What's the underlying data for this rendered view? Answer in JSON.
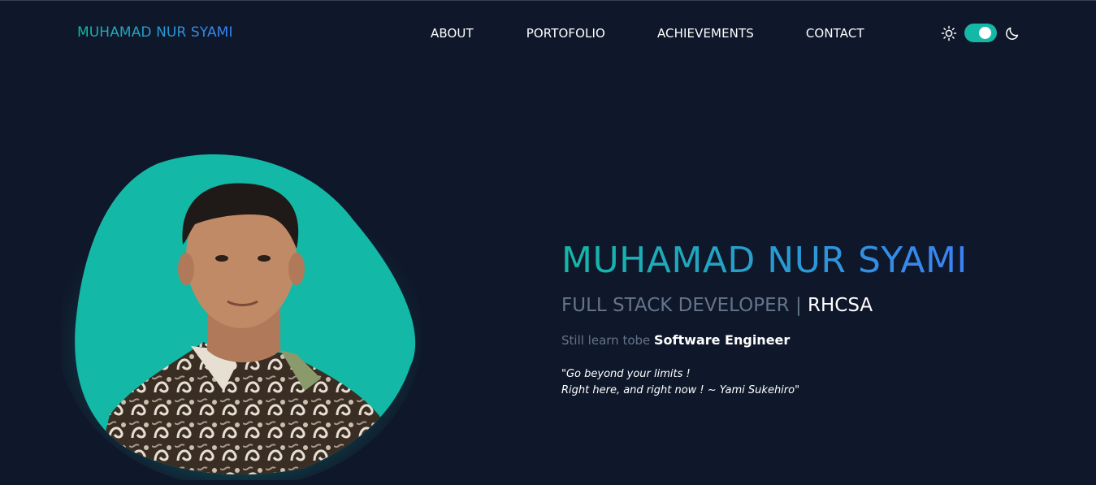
{
  "navbar": {
    "brand": "MUHAMAD NUR SYAMI",
    "links": [
      {
        "label": "ABOUT"
      },
      {
        "label": "PORTOFOLIO"
      },
      {
        "label": "ACHIEVEMENTS"
      },
      {
        "label": "CONTACT"
      }
    ],
    "theme_toggle": {
      "left_icon": "sun-icon",
      "right_icon": "moon-icon",
      "state": "dark"
    }
  },
  "hero": {
    "portrait_icon": "profile-photo",
    "name": "MUHAMAD NUR SYAMI",
    "role_main": "FULL STACK DEVELOPER | ",
    "role_cert": "RHCSA",
    "sub_lead": "Still learn tobe ",
    "sub_strong": "Software Engineer",
    "quote_line1": "\"Go beyond your limits !",
    "quote_line2": "Right here, and right now ! ~ Yami Sukehiro\""
  },
  "colors": {
    "background": "#0f172a",
    "accent_teal": "#14b8a6",
    "accent_blue": "#3b82f6",
    "muted_text": "#64748b",
    "text": "#ffffff"
  }
}
